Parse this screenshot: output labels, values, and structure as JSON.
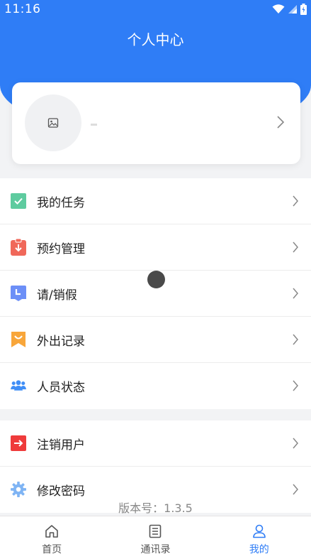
{
  "status_bar": {
    "time": "11:16"
  },
  "header": {
    "title": "个人中心"
  },
  "profile": {
    "avatar_icon": "image-placeholder-icon"
  },
  "menu_group_1": [
    {
      "label": "我的任务",
      "icon": "task-check-icon",
      "color": "#5ecb9f"
    },
    {
      "label": "预约管理",
      "icon": "clipboard-download-icon",
      "color": "#f0685a"
    },
    {
      "label": "请/销假",
      "icon": "clock-calendar-icon",
      "color": "#6c8ff7"
    },
    {
      "label": "外出记录",
      "icon": "bookmark-smile-icon",
      "color": "#f8a63a"
    },
    {
      "label": "人员状态",
      "icon": "people-icon",
      "color": "#3f8ef6"
    }
  ],
  "menu_group_2": [
    {
      "label": "注销用户",
      "icon": "logout-icon",
      "color": "#ef3b3b"
    },
    {
      "label": "修改密码",
      "icon": "gear-icon",
      "color": "#7fb4f4"
    }
  ],
  "version": "版本号：1.3.5",
  "tabs": [
    {
      "label": "首页",
      "icon": "home-icon",
      "active": false
    },
    {
      "label": "通讯录",
      "icon": "contacts-list-icon",
      "active": false
    },
    {
      "label": "我的",
      "icon": "user-icon",
      "active": true
    }
  ],
  "colors": {
    "primary": "#2f7df6"
  }
}
